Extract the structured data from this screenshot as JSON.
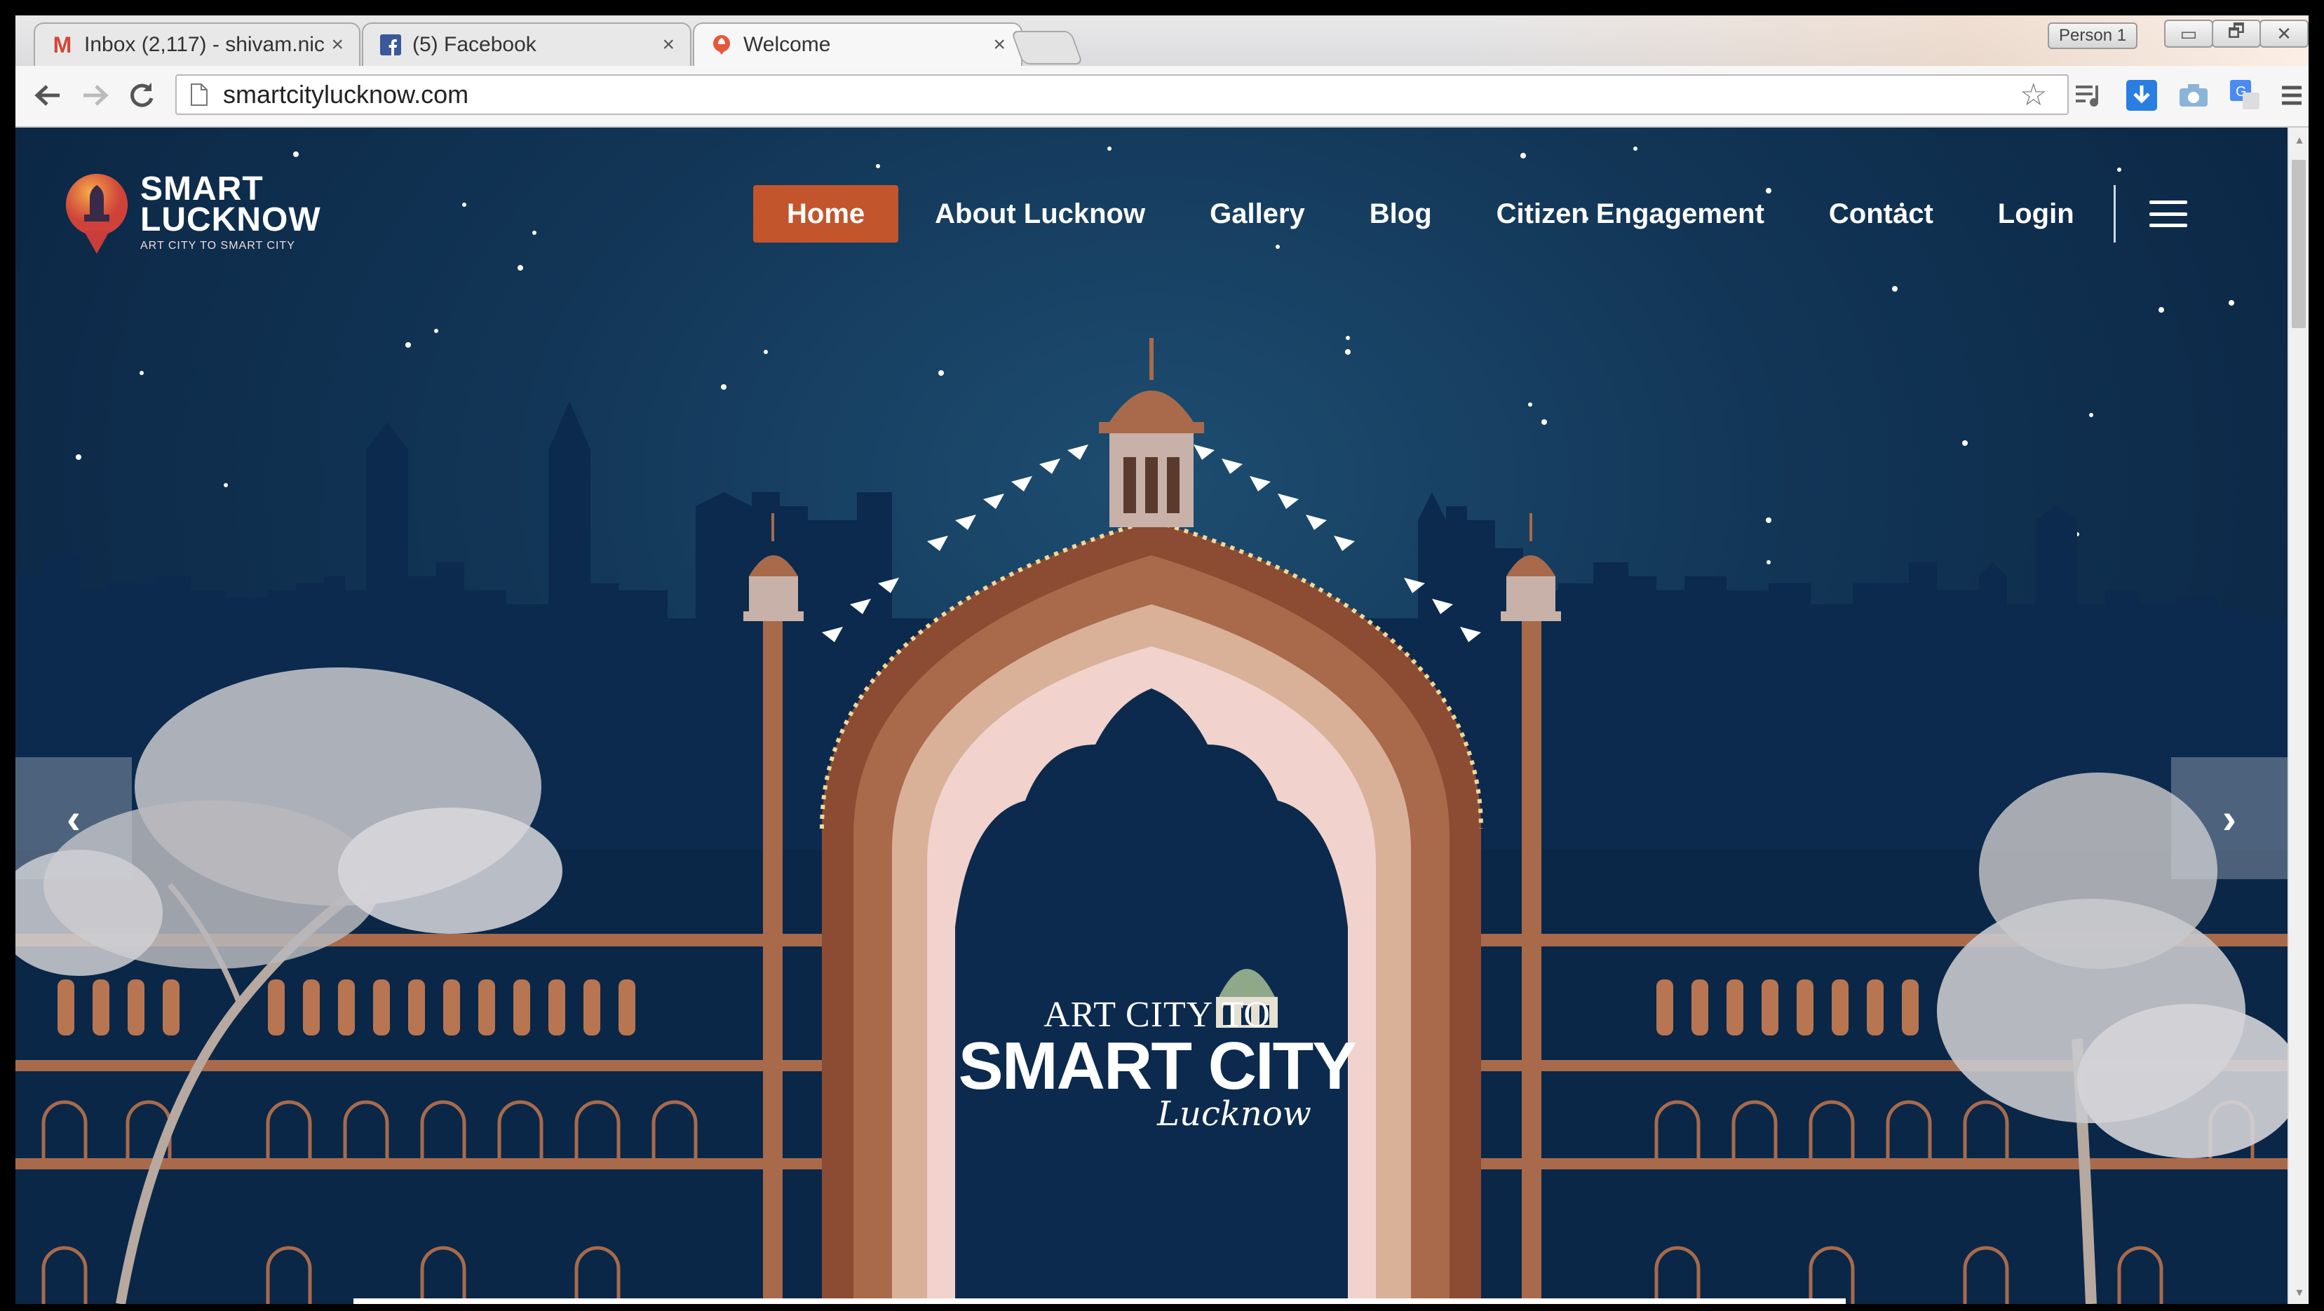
{
  "browser": {
    "tabs": [
      {
        "title": "Inbox (2,117) - shivam.nicl",
        "favicon": "gmail-icon",
        "active": false
      },
      {
        "title": "(5) Facebook",
        "favicon": "facebook-icon",
        "active": false
      },
      {
        "title": "Welcome",
        "favicon": "site-icon",
        "active": true
      }
    ],
    "close_glyph": "×",
    "person_label": "Person 1",
    "url": "smartcitylucknow.com",
    "window_buttons": {
      "minimize": "▭",
      "restore": "🗗",
      "close": "✕"
    }
  },
  "site": {
    "logo": {
      "line1": "SMART",
      "line2": "LUCKNOW",
      "tagline": "ART CITY TO SMART CITY"
    },
    "nav": [
      {
        "label": "Home",
        "active": true
      },
      {
        "label": "About Lucknow",
        "active": false
      },
      {
        "label": "Gallery",
        "active": false
      },
      {
        "label": "Blog",
        "active": false
      },
      {
        "label": "Citizen Engagement",
        "active": false
      },
      {
        "label": "Contact",
        "active": false
      },
      {
        "label": "Login",
        "active": false
      }
    ],
    "slider": {
      "prev": "‹",
      "next": "›"
    },
    "hero": {
      "line1": "ART CITY TO",
      "line2": "SMART CITY",
      "line3": "Lucknow"
    },
    "colors": {
      "accent": "#c2552b",
      "sky": "#123556",
      "skyline": "#0b2a4d",
      "arch": "#a86a4b"
    }
  }
}
